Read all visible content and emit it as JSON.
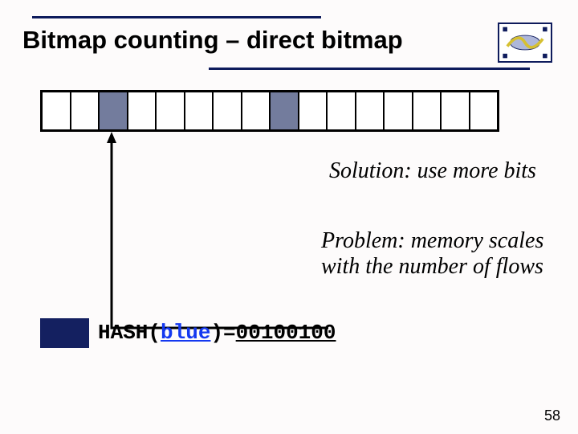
{
  "title": "Bitmap counting – direct bitmap",
  "bitmap": {
    "cells": 16,
    "filled": [
      2,
      8
    ]
  },
  "solution": "Solution: use more bits",
  "problem": "Problem: memory scales with the number of flows",
  "hash": {
    "prefix": "HASH(",
    "arg": "blue",
    "mid": ")=",
    "value": "00100100"
  },
  "page": "58"
}
